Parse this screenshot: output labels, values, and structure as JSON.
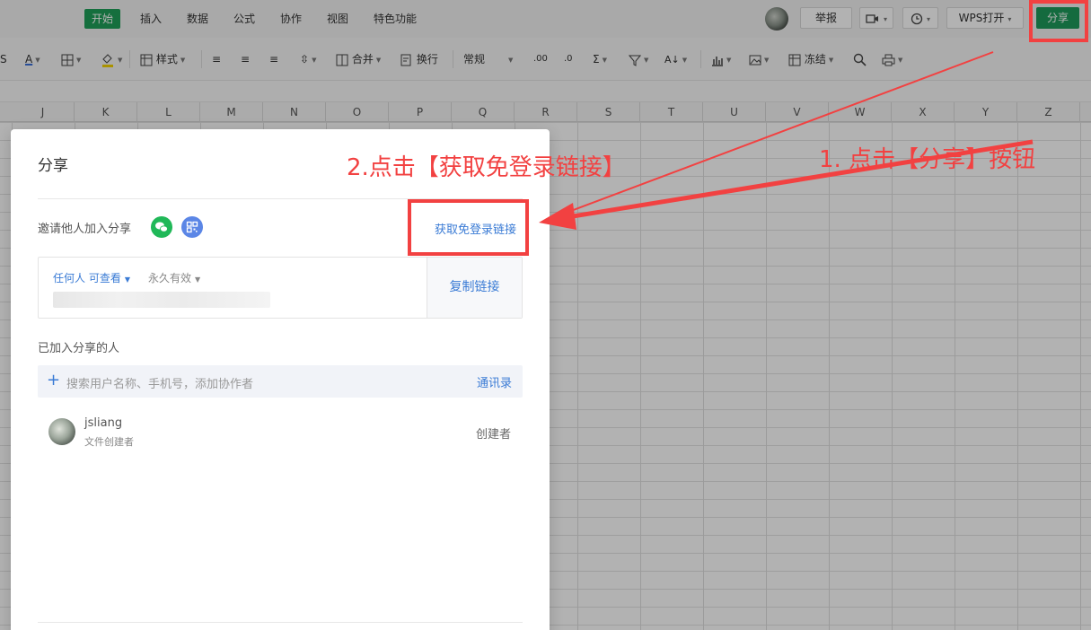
{
  "menubar": {
    "tabs": [
      "开始",
      "插入",
      "数据",
      "公式",
      "协作",
      "视图",
      "特色功能"
    ],
    "report_label": "举报",
    "wps_open_label": "WPS打开",
    "share_label": "分享"
  },
  "toolbar": {
    "style_label": "样式",
    "merge_label": "合并",
    "wrap_label": "换行",
    "number_format": "常规",
    "freeze_label": "冻结"
  },
  "columns": [
    "J",
    "K",
    "L",
    "M",
    "N",
    "O",
    "P",
    "Q",
    "R",
    "S",
    "T",
    "U",
    "V",
    "W",
    "X",
    "Y",
    "Z"
  ],
  "dialog": {
    "title": "分享",
    "invite_label": "邀请他人加入分享",
    "free_login_link": "获取免登录链接",
    "permission": "任何人 可查看",
    "validity": "永久有效",
    "copy_link": "复制链接",
    "joined_label": "已加入分享的人",
    "search_placeholder": "搜索用户名称、手机号，添加协作者",
    "contacts": "通讯录",
    "user": {
      "name": "jsliang",
      "subtitle": "文件创建者",
      "role": "创建者"
    }
  },
  "annotations": {
    "step1": "1. 点击【分享】按钮",
    "step2": "2.点击【获取免登录链接】",
    "highlight_color": "#f24141"
  },
  "colors": {
    "brand_green": "#1e9a5b",
    "link_blue": "#3a7bd5"
  }
}
